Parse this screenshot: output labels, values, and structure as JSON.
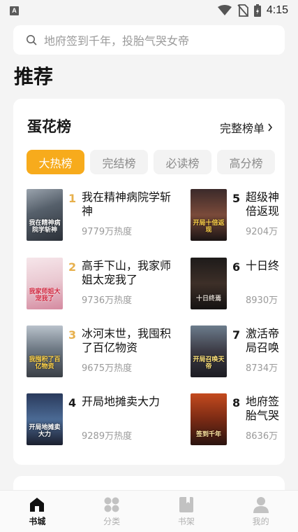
{
  "status_bar": {
    "app_icon_letter": "A",
    "time": "4:15"
  },
  "search": {
    "placeholder": "地府签到千年，投胎气哭女帝"
  },
  "page_title": "推荐",
  "ranking": {
    "title": "蛋花榜",
    "full_list_label": "完整榜单",
    "tabs": [
      {
        "label": "大热榜",
        "active": true
      },
      {
        "label": "完结榜",
        "active": false
      },
      {
        "label": "必读榜",
        "active": false
      },
      {
        "label": "高分榜",
        "active": false
      }
    ],
    "books": [
      {
        "rank": "1",
        "title": "我在精神病院学斩神",
        "heat": "9779万热度",
        "cover_text": "我在精神病院学斩神"
      },
      {
        "rank": "2",
        "title": "高手下山，我家师姐太宠我了",
        "heat": "9736万热度",
        "cover_text": "我家师姐大宠我了"
      },
      {
        "rank": "3",
        "title": "冰河末世，我囤积了百亿物资",
        "heat": "9675万热度",
        "cover_text": "我囤积了百亿物资"
      },
      {
        "rank": "4",
        "title": "开局地摊卖大力",
        "heat": "9289万热度",
        "cover_text": "开局地摊卖大力"
      },
      {
        "rank": "5",
        "title": "超级神",
        "title2": "倍返现",
        "heat": "9204万",
        "cover_text": "开局十倍返现"
      },
      {
        "rank": "6",
        "title": "十日终",
        "heat": "8930万",
        "cover_text": "十日终焉"
      },
      {
        "rank": "7",
        "title": "激活帝",
        "title2": "局召唤",
        "heat": "8734万",
        "cover_text": "开局召唤天帝"
      },
      {
        "rank": "8",
        "title": "地府签",
        "title2": "胎气哭",
        "heat": "8636万",
        "cover_text": "签到千年"
      }
    ]
  },
  "bottom_nav": [
    {
      "label": "书城",
      "icon": "home-icon",
      "active": true
    },
    {
      "label": "分类",
      "icon": "category-icon",
      "active": false
    },
    {
      "label": "书架",
      "icon": "bookshelf-icon",
      "active": false
    },
    {
      "label": "我的",
      "icon": "profile-icon",
      "active": false
    }
  ],
  "colors": {
    "accent": "#f7ab1c",
    "rank_gold": "#e7b04c",
    "muted": "#9a9a9a"
  }
}
